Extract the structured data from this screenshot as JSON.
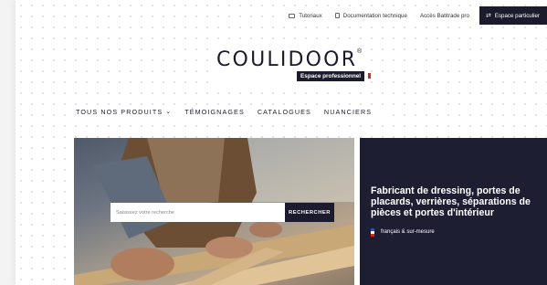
{
  "topbar": {
    "links": [
      {
        "label": "Tutoriaux",
        "icon": "video-icon"
      },
      {
        "label": "Documentation technique",
        "icon": "document-icon"
      },
      {
        "label": "Accès Batitrade pro"
      }
    ],
    "pro_button": {
      "label": "Espace particulier",
      "icon": "swap-arrows-icon"
    }
  },
  "logo": {
    "text": "COULIDOOR",
    "registered": "®",
    "subtitle": "Espace professionnel"
  },
  "nav": {
    "items": [
      {
        "label": "TOUS NOS PRODUITS",
        "has_dropdown": true
      },
      {
        "label": "TÉMOIGNAGES"
      },
      {
        "label": "CATALOGUES"
      },
      {
        "label": "NUANCIERS"
      }
    ]
  },
  "search": {
    "placeholder": "Saisissez votre recherche",
    "button_label": "RECHERCHER"
  },
  "panel": {
    "title": "Fabricant de dressing, portes de placards, verrières, séparations de pièces et portes d'intérieur",
    "tag": "français & sur-mesure"
  },
  "colors": {
    "brand_dark": "#1c1b2e",
    "panel_bg": "#1e1e33",
    "accent_red": "#e2231a"
  }
}
